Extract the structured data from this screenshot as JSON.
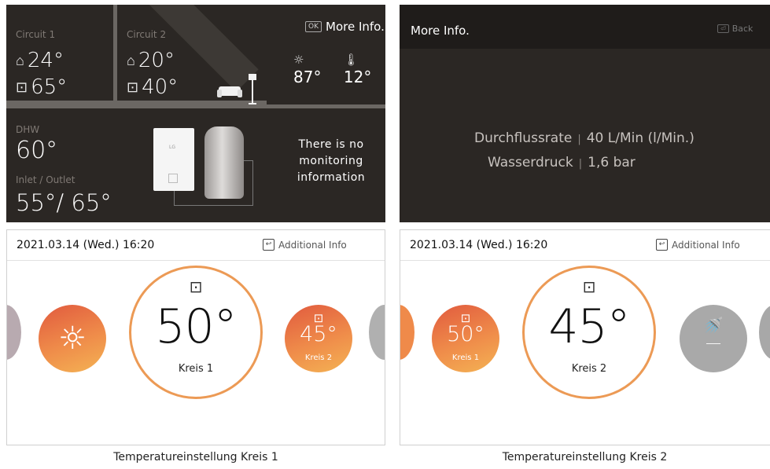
{
  "top_left": {
    "circuit1": {
      "title": "Circuit 1",
      "room_temp": "24°",
      "water_temp": "65°"
    },
    "circuit2": {
      "title": "Circuit 2",
      "room_temp": "20°",
      "water_temp": "40°"
    },
    "ok_key": "OK",
    "more_info_label": "More Info.",
    "outdoor_temp1": "87°",
    "outdoor_temp2": "12°",
    "dhw_title": "DHW",
    "dhw_value": "60°",
    "inlet_title": "Inlet / Outlet",
    "inlet_value": "55°/ 65°",
    "unit_brand": "LG",
    "no_monitoring": "There is no monitoring information"
  },
  "top_right": {
    "title": "More Info.",
    "back_label": "Back",
    "rows": [
      {
        "label": "Durchflussrate",
        "value": "40 L/Min (l/Min.)"
      },
      {
        "label": "Wasserdruck",
        "value": "1,6 bar"
      }
    ]
  },
  "bottom_left": {
    "datetime": "2021.03.14 (Wed.) 16:20",
    "additional_info": "Additional Info",
    "main_temp": "50°",
    "main_label": "Kreis 1",
    "side_temp": "45°",
    "side_label": "Kreis 2",
    "caption": "Temperatureinstellung Kreis 1"
  },
  "bottom_right": {
    "datetime": "2021.03.14 (Wed.) 16:20",
    "additional_info": "Additional Info",
    "main_temp": "45°",
    "main_label": "Kreis 2",
    "side_temp": "50°",
    "side_label": "Kreis 1",
    "dash": "—",
    "caption": "Temperatureinstellung Kreis 2"
  }
}
